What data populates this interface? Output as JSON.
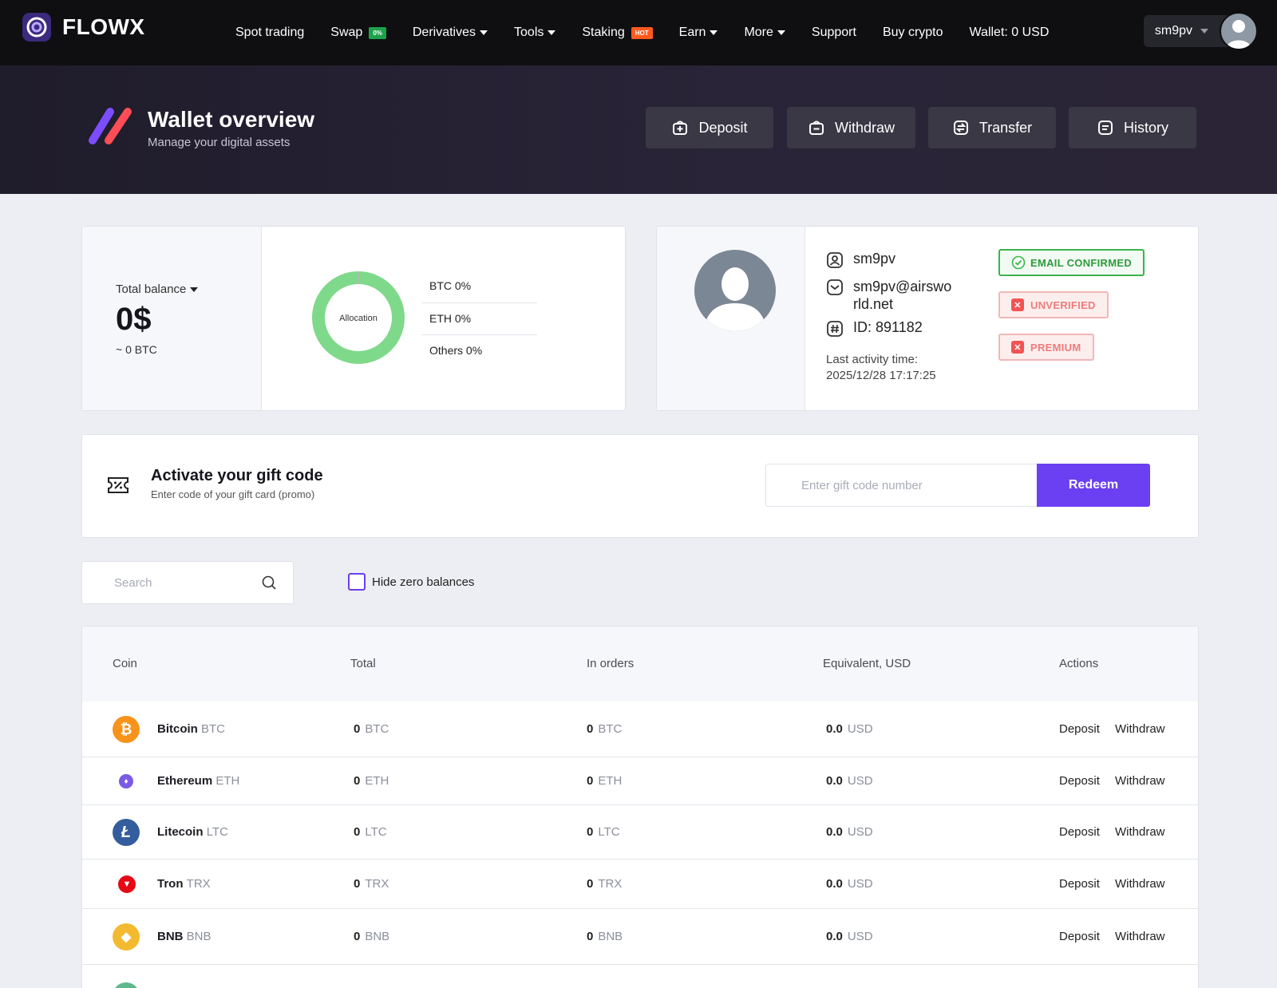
{
  "brand": "FLOWX",
  "nav": {
    "spot": "Spot trading",
    "swap": "Swap",
    "swap_tag": "0%",
    "derivatives": "Derivatives",
    "tools": "Tools",
    "staking": "Staking",
    "staking_tag": "HOT",
    "earn": "Earn",
    "more": "More",
    "support": "Support",
    "buy": "Buy crypto",
    "wallet": "Wallet: 0 USD",
    "user": "sm9pv"
  },
  "hero": {
    "title": "Wallet overview",
    "subtitle": "Manage your digital assets",
    "deposit": "Deposit",
    "withdraw": "Withdraw",
    "transfer": "Transfer",
    "history": "History"
  },
  "balance": {
    "label": "Total balance",
    "value": "0$",
    "btc": "~ 0 BTC",
    "allocation_label": "Allocation",
    "allocation": [
      {
        "label": "BTC 0%"
      },
      {
        "label": "ETH 0%"
      },
      {
        "label": "Others 0%"
      }
    ]
  },
  "profile": {
    "username": "sm9pv",
    "email": "sm9pv@airswo",
    "email2": "rld.net",
    "id": "ID: 891182",
    "activity_label": "Last activity time:",
    "activity_time": "2025/12/28 17:17:25",
    "badge_email": "EMAIL CONFIRMED",
    "badge_unverified": "UNVERIFIED",
    "badge_premium": "PREMIUM"
  },
  "gift": {
    "title": "Activate your gift code",
    "subtitle": "Enter code of your gift card (promo)",
    "placeholder": "Enter gift code number",
    "button": "Redeem"
  },
  "filters": {
    "search_placeholder": "Search",
    "hide_zero": "Hide zero balances"
  },
  "table": {
    "headers": {
      "coin": "Coin",
      "total": "Total",
      "orders": "In orders",
      "equiv": "Equivalent, USD",
      "actions": "Actions"
    },
    "deposit_label": "Deposit",
    "withdraw_label": "Withdraw",
    "rows": [
      {
        "name": "Bitcoin",
        "sym": "BTC",
        "total": "0",
        "orders": "0",
        "equiv": "0.0",
        "unit": "USD",
        "color": "#f7931a"
      },
      {
        "name": "Ethereum",
        "sym": "ETH",
        "total": "0",
        "orders": "0",
        "equiv": "0.0",
        "unit": "USD",
        "color": "#7b5be6"
      },
      {
        "name": "Litecoin",
        "sym": "LTC",
        "total": "0",
        "orders": "0",
        "equiv": "0.0",
        "unit": "USD",
        "color": "#345d9d"
      },
      {
        "name": "Tron",
        "sym": "TRX",
        "total": "0",
        "orders": "0",
        "equiv": "0.0",
        "unit": "USD",
        "color": "#e50914"
      },
      {
        "name": "BNB",
        "sym": "BNB",
        "total": "0",
        "orders": "0",
        "equiv": "0.0",
        "unit": "USD",
        "color": "#f3ba2f"
      }
    ]
  },
  "colors": {
    "accent": "#6b3ff2",
    "nav_bg": "#0f0f12",
    "success": "#3bb54a",
    "danger": "#f05454",
    "donut": "#7fd98a"
  }
}
